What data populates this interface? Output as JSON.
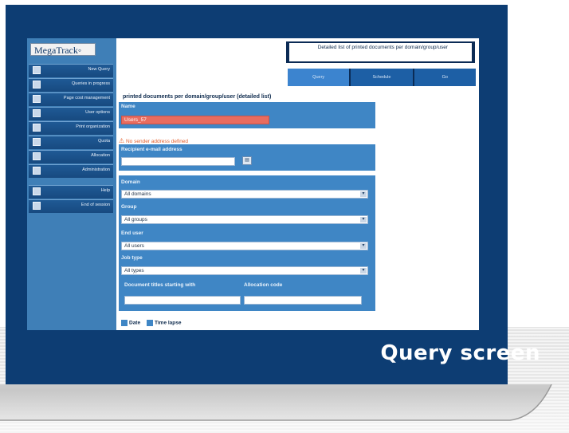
{
  "caption": "Query screen",
  "app": {
    "logo": "MegaTrack",
    "sidebar": {
      "items": [
        {
          "label": "New Query",
          "icon": "document-icon"
        },
        {
          "label": "Queries in progress",
          "icon": "list-icon"
        },
        {
          "label": "Page cost management",
          "icon": "pen-icon"
        },
        {
          "label": "User options",
          "icon": "settings-icon"
        },
        {
          "label": "Print organization",
          "icon": "printer-icon"
        },
        {
          "label": "Quota",
          "icon": "quota-icon"
        },
        {
          "label": "Allocation",
          "icon": "allocation-icon"
        },
        {
          "label": "Administration",
          "icon": "admin-icon"
        }
      ],
      "bottom_items": [
        {
          "label": "Help",
          "icon": "help-icon"
        },
        {
          "label": "End of session",
          "icon": "logout-icon"
        }
      ]
    },
    "header": {
      "title": "Detailed list of printed documents per domain/group/user"
    },
    "tabs": [
      "Query",
      "Schedule",
      "Go"
    ],
    "form": {
      "title": "printed documents per domain/group/user (detailed list)",
      "name_label": "Name",
      "name_value": "Users_57",
      "warning": "No sender address defined",
      "recipient_label": "Recipient e-mail address",
      "recipient_value": "",
      "domain_label": "Domain",
      "domain_value": "All domains",
      "group_label": "Group",
      "group_value": "All groups",
      "end_user_label": "End user",
      "end_user_value": "All users",
      "job_type_label": "Job type",
      "job_type_value": "All types",
      "doc_titles_label": "Document titles starting with",
      "doc_titles_value": "",
      "allocation_label": "Allocation code",
      "allocation_value": "",
      "date_label": "Date",
      "time_lapse_label": "Time lapse"
    }
  },
  "colors": {
    "frame": "#0d3d73",
    "sidebar": "#3f7fb7",
    "panel": "#3f86c5",
    "warning": "#e4602f"
  }
}
